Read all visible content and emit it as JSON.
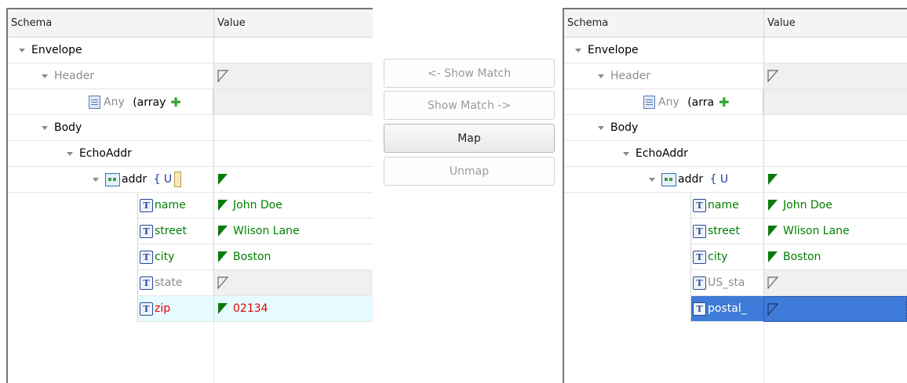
{
  "buttons": {
    "show_match_left": "<- Show Match",
    "show_match_right": "Show Match ->",
    "map": "Map",
    "unmap": "Unmap"
  },
  "left": {
    "header": {
      "schema": "Schema",
      "value": "Value"
    },
    "rows": [
      {
        "name": "Envelope",
        "value": ""
      },
      {
        "name": "Header",
        "value": ""
      },
      {
        "name": "Any",
        "extra": "(array",
        "value": ""
      },
      {
        "name": "Body",
        "value": ""
      },
      {
        "name": "EchoAddr",
        "value": ""
      },
      {
        "name": "addr",
        "extra": "{ U",
        "value": ""
      },
      {
        "name": "name",
        "value": "John Doe"
      },
      {
        "name": "street",
        "value": "Wlison Lane"
      },
      {
        "name": "city",
        "value": "Boston"
      },
      {
        "name": "state",
        "value": ""
      },
      {
        "name": "zip",
        "value": "02134"
      }
    ]
  },
  "right": {
    "header": {
      "schema": "Schema",
      "value": "Value"
    },
    "rows": [
      {
        "name": "Envelope",
        "value": ""
      },
      {
        "name": "Header",
        "value": ""
      },
      {
        "name": "Any",
        "extra": "(arra",
        "value": ""
      },
      {
        "name": "Body",
        "value": ""
      },
      {
        "name": "EchoAddr",
        "value": ""
      },
      {
        "name": "addr",
        "extra": "{ U",
        "value": ""
      },
      {
        "name": "name",
        "value": "John Doe"
      },
      {
        "name": "street",
        "value": "Wlison Lane"
      },
      {
        "name": "city",
        "value": "Boston"
      },
      {
        "name": "US_sta",
        "value": ""
      },
      {
        "name": "postal_",
        "value": ""
      }
    ]
  },
  "colors": {
    "mapped": "#008000",
    "unmapped": "#8c8c8c",
    "selected_zip": "#e00000",
    "selection": "#3f7bd8"
  }
}
